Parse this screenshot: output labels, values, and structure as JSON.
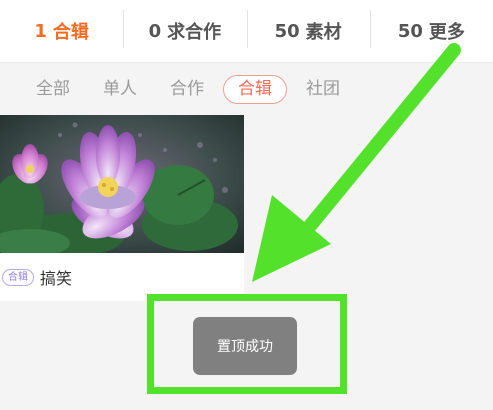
{
  "top_tabs": [
    {
      "count": "1",
      "label": "合辑",
      "active": true
    },
    {
      "count": "0",
      "label": "求合作",
      "active": false
    },
    {
      "count": "50",
      "label": "素材",
      "active": false
    },
    {
      "count": "50",
      "label": "更多",
      "active": false
    }
  ],
  "filters": [
    {
      "label": "全部",
      "active": false
    },
    {
      "label": "单人",
      "active": false
    },
    {
      "label": "合作",
      "active": false
    },
    {
      "label": "合辑",
      "active": true
    },
    {
      "label": "社团",
      "active": false
    }
  ],
  "card": {
    "tag": "合辑",
    "title": "搞笑"
  },
  "toast": {
    "text": "置顶成功"
  },
  "colors": {
    "accent": "#f36c21",
    "chip_active": "#f36c5a",
    "annotation_green": "#54e12c",
    "toast_bg": "#808080"
  }
}
